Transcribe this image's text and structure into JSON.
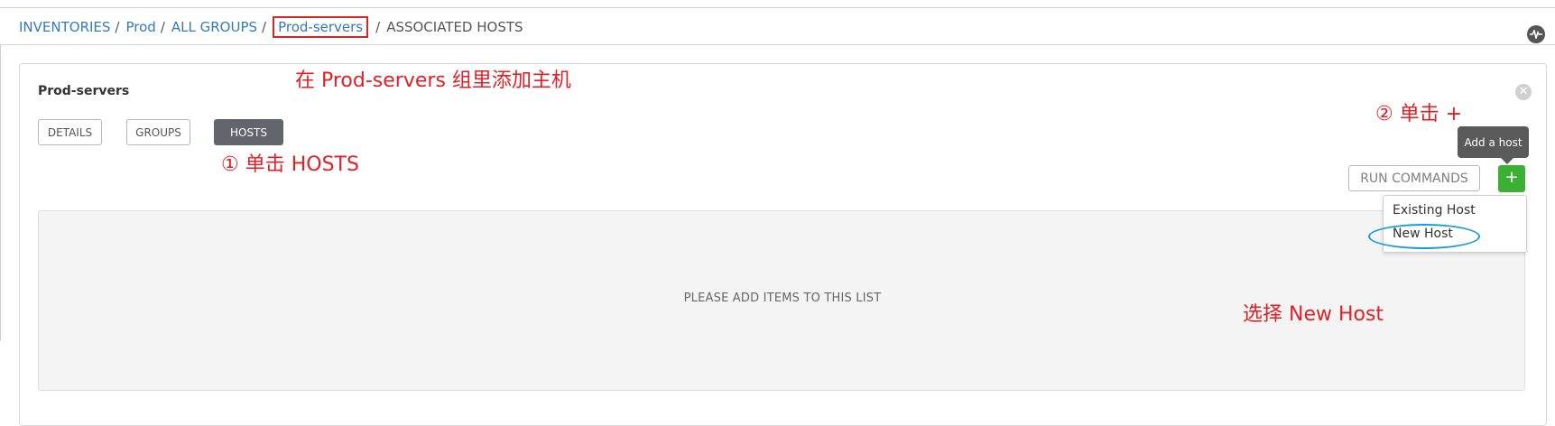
{
  "breadcrumb": {
    "items": [
      "INVENTORIES",
      "Prod",
      "ALL GROUPS",
      "Prod-servers"
    ],
    "separator": "/",
    "current": "ASSOCIATED HOSTS"
  },
  "panel": {
    "title": "Prod-servers",
    "tabs": [
      "DETAILS",
      "GROUPS",
      "HOSTS"
    ],
    "active_tab": "HOSTS",
    "run_commands_label": "RUN COMMANDS",
    "add_label": "+",
    "add_tooltip": "Add a host",
    "dropdown": {
      "items": [
        "Existing Host",
        "New Host"
      ]
    },
    "empty_message": "PLEASE ADD ITEMS TO THIS LIST"
  },
  "annotations": {
    "group_note": "在 Prod-servers 组里添加主机",
    "step1": "① 单击 HOSTS",
    "step2": "② 单击 +",
    "choose": "选择 New Host"
  },
  "colors": {
    "link": "#337ab7",
    "annotation": "#e31e24",
    "add_button": "#3cb035",
    "active_tab": "#62656c",
    "ellipse": "#1e9ad6"
  },
  "icons": {
    "activity": "activity-stream-icon",
    "close": "close-icon"
  }
}
